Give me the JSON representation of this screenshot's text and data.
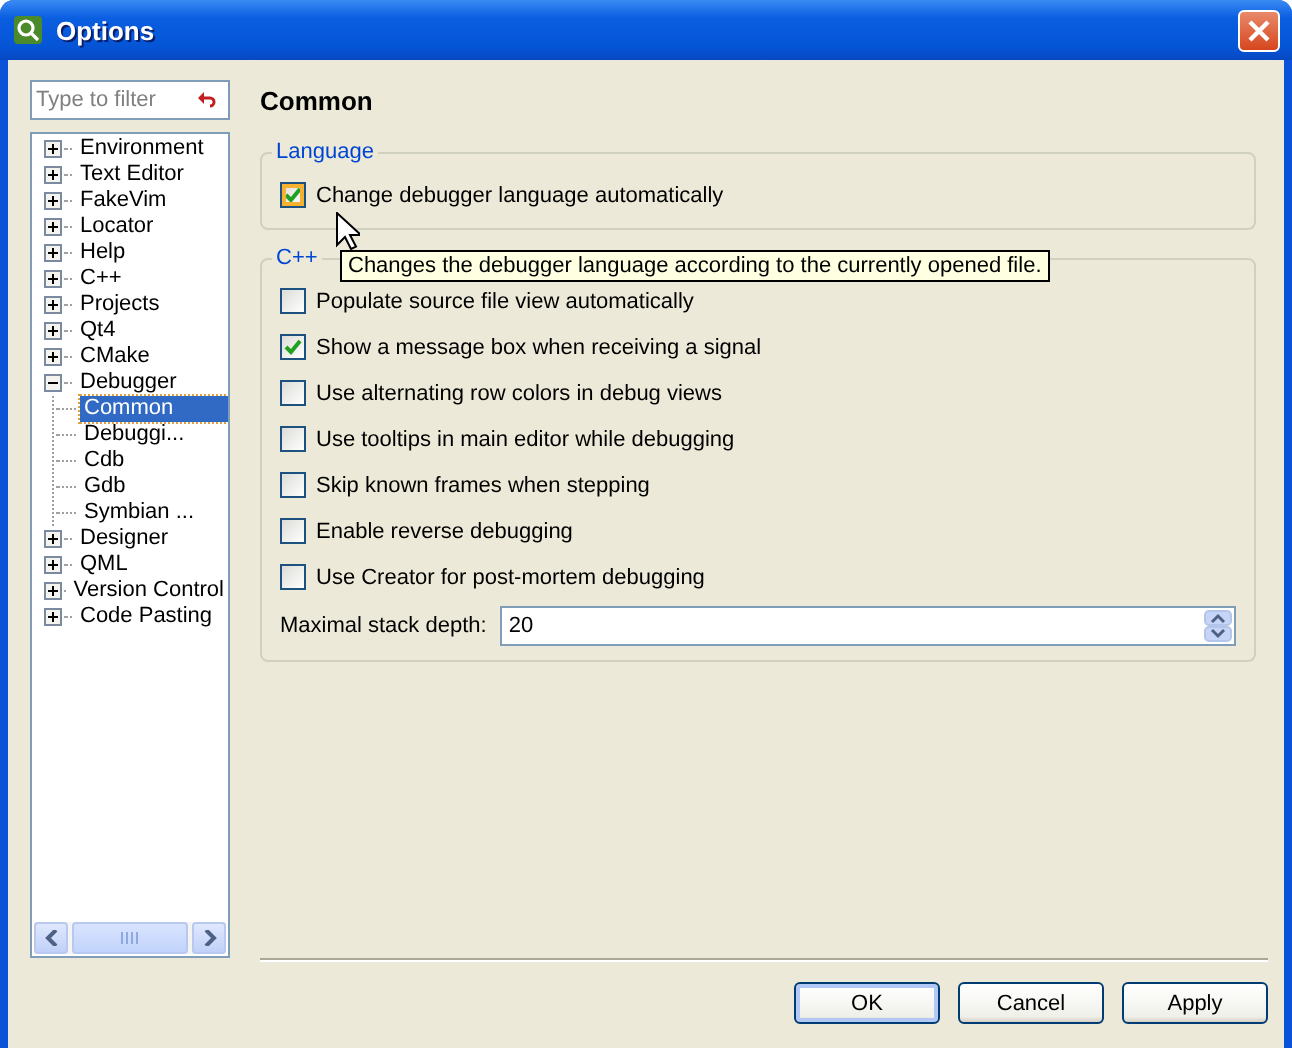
{
  "window": {
    "title": "Options"
  },
  "sidebar": {
    "filter": {
      "placeholder": "Type to filter"
    },
    "tree": [
      {
        "label": "Environment",
        "expanded": false,
        "selected": false
      },
      {
        "label": "Text Editor",
        "expanded": false,
        "selected": false
      },
      {
        "label": "FakeVim",
        "expanded": false,
        "selected": false
      },
      {
        "label": "Locator",
        "expanded": false,
        "selected": false
      },
      {
        "label": "Help",
        "expanded": false,
        "selected": false
      },
      {
        "label": "C++",
        "expanded": false,
        "selected": false
      },
      {
        "label": "Projects",
        "expanded": false,
        "selected": false
      },
      {
        "label": "Qt4",
        "expanded": false,
        "selected": false
      },
      {
        "label": "CMake",
        "expanded": false,
        "selected": false
      },
      {
        "label": "Debugger",
        "expanded": true,
        "selected": false,
        "children": [
          {
            "label": "Common",
            "selected": true
          },
          {
            "label": "Debuggi...",
            "selected": false
          },
          {
            "label": "Cdb",
            "selected": false
          },
          {
            "label": "Gdb",
            "selected": false
          },
          {
            "label": "Symbian ...",
            "selected": false
          }
        ]
      },
      {
        "label": "Designer",
        "expanded": false,
        "selected": false
      },
      {
        "label": "QML",
        "expanded": false,
        "selected": false
      },
      {
        "label": "Version Control",
        "expanded": false,
        "selected": false
      },
      {
        "label": "Code Pasting",
        "expanded": false,
        "selected": false
      }
    ]
  },
  "page": {
    "title": "Common",
    "groups": [
      {
        "title": "Language",
        "options": [
          {
            "label": "Change debugger language automatically",
            "checked": true,
            "hovered": true
          }
        ]
      },
      {
        "title": "C++",
        "options": [
          {
            "label": "Populate source file view automatically",
            "checked": false,
            "hovered": false
          },
          {
            "label": "Show a message box when receiving a signal",
            "checked": true,
            "hovered": false
          },
          {
            "label": "Use alternating row colors in debug views",
            "checked": false,
            "hovered": false
          },
          {
            "label": "Use tooltips in main editor while debugging",
            "checked": false,
            "hovered": false
          },
          {
            "label": "Skip known frames when stepping",
            "checked": false,
            "hovered": false
          },
          {
            "label": "Enable reverse debugging",
            "checked": false,
            "hovered": false
          },
          {
            "label": "Use Creator for post-mortem debugging",
            "checked": false,
            "hovered": false
          }
        ],
        "spin": {
          "label": "Maximal stack depth:",
          "value": "20"
        }
      }
    ]
  },
  "tooltip": {
    "text": "Changes the debugger language according to the currently opened file."
  },
  "buttons": [
    {
      "label": "OK",
      "default": true
    },
    {
      "label": "Cancel",
      "default": false
    },
    {
      "label": "Apply",
      "default": false
    }
  ]
}
